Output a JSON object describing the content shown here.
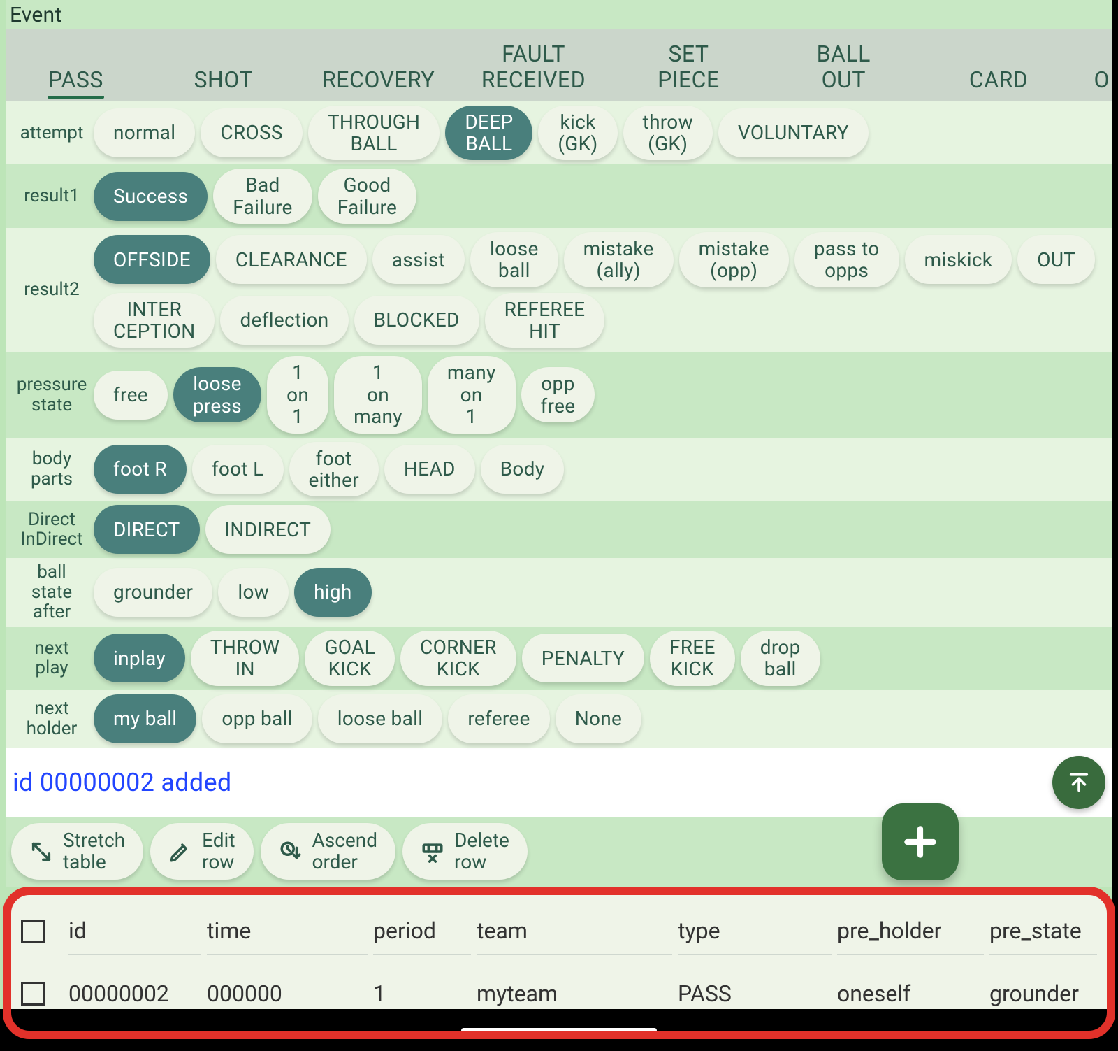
{
  "panel": {
    "title": "Event"
  },
  "tabs": [
    {
      "label": "PASS",
      "active": true
    },
    {
      "label": "SHOT"
    },
    {
      "label": "RECOVERY"
    },
    {
      "label": "FAULT\nRECEIVED"
    },
    {
      "label": "SET\nPIECE"
    },
    {
      "label": "BALL\nOUT"
    },
    {
      "label": "CARD"
    },
    {
      "label": "O"
    }
  ],
  "rows": [
    {
      "label": "attempt",
      "options": [
        {
          "label": "normal"
        },
        {
          "label": "CROSS"
        },
        {
          "label": "THROUGH\nBALL"
        },
        {
          "label": "DEEP\nBALL",
          "selected": true
        },
        {
          "label": "kick\n(GK)"
        },
        {
          "label": "throw\n(GK)"
        },
        {
          "label": "VOLUNTARY"
        }
      ]
    },
    {
      "label": "result1",
      "options": [
        {
          "label": "Success",
          "selected": true
        },
        {
          "label": "Bad\nFailure"
        },
        {
          "label": "Good\nFailure"
        }
      ]
    },
    {
      "label": "result2",
      "options": [
        {
          "label": "OFFSIDE",
          "selected": true
        },
        {
          "label": "CLEARANCE"
        },
        {
          "label": "assist"
        },
        {
          "label": "loose\nball"
        },
        {
          "label": "mistake\n(ally)"
        },
        {
          "label": "mistake\n(opp)"
        },
        {
          "label": "pass to\nopps"
        },
        {
          "label": "miskick"
        },
        {
          "label": "OUT"
        },
        {
          "label": "INTER\nCEPTION"
        },
        {
          "label": "deflection"
        },
        {
          "label": "BLOCKED"
        },
        {
          "label": "REFEREE\nHIT"
        }
      ]
    },
    {
      "label": "pressure\nstate",
      "options": [
        {
          "label": "free"
        },
        {
          "label": "loose\npress",
          "selected": true
        },
        {
          "label": "1\non\n1"
        },
        {
          "label": "1\non\nmany"
        },
        {
          "label": "many\non\n1"
        },
        {
          "label": "opp\nfree"
        }
      ]
    },
    {
      "label": "body\nparts",
      "options": [
        {
          "label": "foot R",
          "selected": true
        },
        {
          "label": "foot L"
        },
        {
          "label": "foot\neither"
        },
        {
          "label": "HEAD"
        },
        {
          "label": "Body"
        }
      ]
    },
    {
      "label": "Direct\nInDirect",
      "options": [
        {
          "label": "DIRECT",
          "selected": true
        },
        {
          "label": "INDIRECT"
        }
      ]
    },
    {
      "label": "ball\nstate\nafter",
      "options": [
        {
          "label": "grounder"
        },
        {
          "label": "low"
        },
        {
          "label": "high",
          "selected": true
        }
      ]
    },
    {
      "label": "next\nplay",
      "options": [
        {
          "label": "inplay",
          "selected": true
        },
        {
          "label": "THROW\nIN"
        },
        {
          "label": "GOAL\nKICK"
        },
        {
          "label": "CORNER\nKICK"
        },
        {
          "label": "PENALTY"
        },
        {
          "label": "FREE\nKICK"
        },
        {
          "label": "drop\nball"
        }
      ]
    },
    {
      "label": "next\nholder",
      "options": [
        {
          "label": "my ball",
          "selected": true
        },
        {
          "label": "opp ball"
        },
        {
          "label": "loose ball"
        },
        {
          "label": "referee"
        },
        {
          "label": "None"
        }
      ]
    }
  ],
  "status": {
    "text": "id 00000002 added"
  },
  "toolbar": {
    "stretch": "Stretch\ntable",
    "edit": "Edit\nrow",
    "ascend": "Ascend\norder",
    "delete": "Delete\nrow"
  },
  "table": {
    "headers": [
      "id",
      "time",
      "period",
      "team",
      "type",
      "pre_holder",
      "pre_state"
    ],
    "rows": [
      {
        "id": "00000002",
        "time": "000000",
        "period": "1",
        "team": "myteam",
        "type": "PASS",
        "pre_holder": "oneself",
        "pre_state": "grounder"
      }
    ]
  }
}
